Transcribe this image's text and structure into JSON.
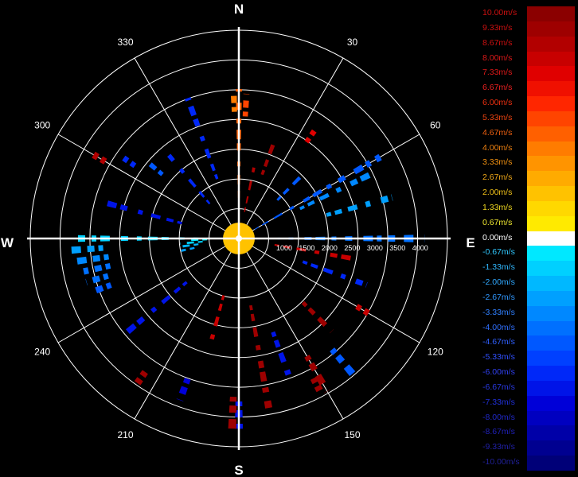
{
  "chart_data": {
    "type": "polar radar (velocity)",
    "compass": {
      "north": "N",
      "east": "E",
      "south": "S",
      "west": "W"
    },
    "bearing_labels": [
      {
        "deg": 30,
        "text": "30"
      },
      {
        "deg": 60,
        "text": "60"
      },
      {
        "deg": 120,
        "text": "120"
      },
      {
        "deg": 150,
        "text": "150"
      },
      {
        "deg": 210,
        "text": "210"
      },
      {
        "deg": 240,
        "text": "240"
      },
      {
        "deg": 300,
        "text": "300"
      },
      {
        "deg": 330,
        "text": "330"
      }
    ],
    "range_labels": [
      "1000",
      "1500",
      "2000",
      "2500",
      "3000",
      "3500",
      "4000"
    ],
    "max_range": 4600,
    "colorbar": [
      {
        "label": "10.00m/s",
        "color": "#8b0000",
        "text_color": "#cc1010"
      },
      {
        "label": "9.33m/s",
        "color": "#9e0000",
        "text_color": "#cc1010"
      },
      {
        "label": "8.67m/s",
        "color": "#b20000",
        "text_color": "#cc1010"
      },
      {
        "label": "8.00m/s",
        "color": "#c80000",
        "text_color": "#dd1818"
      },
      {
        "label": "7.33m/s",
        "color": "#e00000",
        "text_color": "#dd1818"
      },
      {
        "label": "6.67m/s",
        "color": "#f01000",
        "text_color": "#ee2020"
      },
      {
        "label": "6.00m/s",
        "color": "#ff2600",
        "text_color": "#ee3010"
      },
      {
        "label": "5.33m/s",
        "color": "#ff4400",
        "text_color": "#ee4410"
      },
      {
        "label": "4.67m/s",
        "color": "#ff6000",
        "text_color": "#ee6010"
      },
      {
        "label": "4.00m/s",
        "color": "#ff7c00",
        "text_color": "#ee8010"
      },
      {
        "label": "3.33m/s",
        "color": "#ff9400",
        "text_color": "#f09010"
      },
      {
        "label": "2.67m/s",
        "color": "#ffab00",
        "text_color": "#f0a818"
      },
      {
        "label": "2.00m/s",
        "color": "#ffc200",
        "text_color": "#f0c018"
      },
      {
        "label": "1.33m/s",
        "color": "#ffd800",
        "text_color": "#f0d820"
      },
      {
        "label": "0.67m/s",
        "color": "#ffea00",
        "text_color": "#f0e830"
      },
      {
        "label": "0.00m/s",
        "color": "#ffffff",
        "text_color": "#ffffff"
      },
      {
        "label": "-0.67m/s",
        "color": "#00e8ff",
        "text_color": "#30c8ff"
      },
      {
        "label": "-1.33m/s",
        "color": "#00d0ff",
        "text_color": "#30b8ff"
      },
      {
        "label": "-2.00m/s",
        "color": "#00b8ff",
        "text_color": "#30a8ff"
      },
      {
        "label": "-2.67m/s",
        "color": "#00a0ff",
        "text_color": "#3098ff"
      },
      {
        "label": "-3.33m/s",
        "color": "#0088ff",
        "text_color": "#3080ff"
      },
      {
        "label": "-4.00m/s",
        "color": "#0070ff",
        "text_color": "#3070ff"
      },
      {
        "label": "-4.67m/s",
        "color": "#0058ff",
        "text_color": "#3060ff"
      },
      {
        "label": "-5.33m/s",
        "color": "#0040ff",
        "text_color": "#3050ff"
      },
      {
        "label": "-6.00m/s",
        "color": "#0028f8",
        "text_color": "#3040f0"
      },
      {
        "label": "-6.67m/s",
        "color": "#0014e8",
        "text_color": "#2838e0"
      },
      {
        "label": "-7.33m/s",
        "color": "#0000d8",
        "text_color": "#2030d8"
      },
      {
        "label": "-8.00m/s",
        "color": "#0000c0",
        "text_color": "#2028c8"
      },
      {
        "label": "-8.67m/s",
        "color": "#0000a8",
        "text_color": "#2020b8"
      },
      {
        "label": "-9.33m/s",
        "color": "#000090",
        "text_color": "#2020a8"
      },
      {
        "label": "-10.00m/s",
        "color": "#000078",
        "text_color": "#202098"
      }
    ],
    "returns": [
      {
        "az": 270,
        "r": [
          300,
          3700
        ],
        "v": -1.5
      },
      {
        "az": 268,
        "r": [
          700,
          1100
        ],
        "v": -0.8
      },
      {
        "az": 265,
        "r": [
          800,
          1300
        ],
        "v": -1.2
      },
      {
        "az": 262,
        "r": [
          900,
          1300
        ],
        "v": -2.2
      },
      {
        "az": 258,
        "r": [
          1000,
          1300
        ],
        "v": -2.8
      },
      {
        "az": 266,
        "r": [
          3000,
          3700
        ],
        "v": -2.6
      },
      {
        "az": 262,
        "r": [
          2900,
          3600
        ],
        "v": -3.5
      },
      {
        "az": 258,
        "r": [
          2900,
          3500
        ],
        "v": -3.8
      },
      {
        "az": 254,
        "r": [
          3000,
          3500
        ],
        "v": -4.0
      },
      {
        "az": 250,
        "r": [
          3000,
          3400
        ],
        "v": -4.5
      },
      {
        "az": 90,
        "r": [
          200,
          4100
        ],
        "v": -4.0
      },
      {
        "az": 60,
        "r": [
          400,
          3600
        ],
        "v": -4.5
      },
      {
        "az": 64,
        "r": [
          1500,
          3200
        ],
        "v": -3.5
      },
      {
        "az": 0,
        "r": [
          700,
          3300
        ],
        "v": 4.5
      },
      {
        "az": 358,
        "r": [
          2800,
          3200
        ],
        "v": 4.0
      },
      {
        "az": 3,
        "r": [
          2700,
          3200
        ],
        "v": 5.0
      },
      {
        "az": 35,
        "r": [
          2600,
          2900
        ],
        "v": 7.5
      },
      {
        "az": 150,
        "r": [
          3000,
          3900
        ],
        "v": 9.0
      },
      {
        "az": 152,
        "r": [
          3500,
          3800
        ],
        "v": 9.5
      },
      {
        "az": 120,
        "r": [
          3000,
          3300
        ],
        "v": 8.0
      },
      {
        "az": 300,
        "r": [
          3400,
          3700
        ],
        "v": 8.5
      },
      {
        "az": 305,
        "r": [
          2800,
          3100
        ],
        "v": -6.0
      },
      {
        "az": 310,
        "r": [
          2200,
          2600
        ],
        "v": -5.0
      },
      {
        "az": 180,
        "r": [
          3600,
          4200
        ],
        "v": -7.0
      },
      {
        "az": 182,
        "r": [
          3500,
          4300
        ],
        "v": 9.0
      },
      {
        "az": 200,
        "r": [
          3300,
          3800
        ],
        "v": -7.5
      },
      {
        "az": 215,
        "r": [
          3600,
          3900
        ],
        "v": 9.5
      },
      {
        "az": 20,
        "r": [
          1500,
          2200
        ],
        "v": 9.0
      },
      {
        "az": 45,
        "r": [
          1200,
          2000
        ],
        "v": -5.0
      },
      {
        "az": 75,
        "r": [
          2000,
          3500
        ],
        "v": -3.0
      },
      {
        "az": 100,
        "r": [
          800,
          2600
        ],
        "v": 8.0
      },
      {
        "az": 110,
        "r": [
          1500,
          3000
        ],
        "v": -6.0
      },
      {
        "az": 135,
        "r": [
          2000,
          2900
        ],
        "v": 9.0
      },
      {
        "az": 160,
        "r": [
          2200,
          3400
        ],
        "v": -7.0
      },
      {
        "az": 195,
        "r": [
          1300,
          2500
        ],
        "v": 8.0
      },
      {
        "az": 230,
        "r": [
          1500,
          3200
        ],
        "v": -6.5
      },
      {
        "az": 285,
        "r": [
          1300,
          3000
        ],
        "v": -7.0
      },
      {
        "az": 320,
        "r": [
          1000,
          2400
        ],
        "v": -6.0
      },
      {
        "az": 340,
        "r": [
          1400,
          3300
        ],
        "v": -6.0
      },
      {
        "az": 12,
        "r": [
          600,
          1800
        ],
        "v": 8.5
      },
      {
        "az": 170,
        "r": [
          1500,
          3800
        ],
        "v": 9.0
      },
      {
        "az": 140,
        "r": [
          3200,
          3900
        ],
        "v": -5.0
      }
    ]
  }
}
